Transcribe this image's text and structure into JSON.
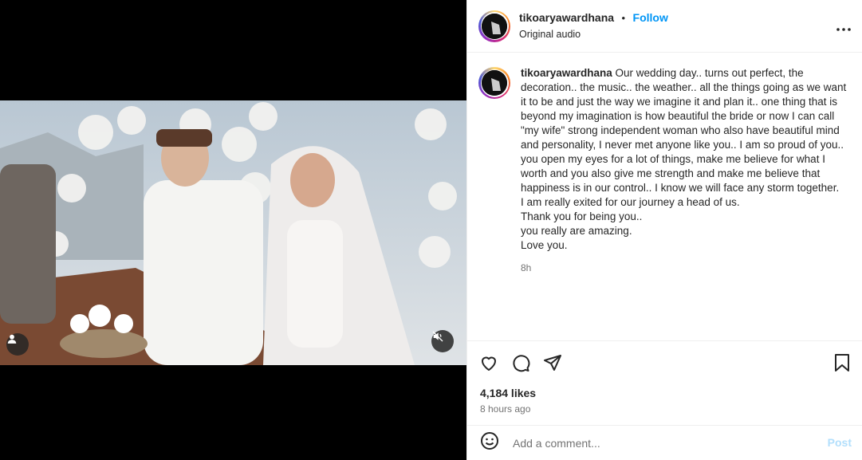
{
  "post": {
    "username": "tikoaryawardhana",
    "separator": "•",
    "follow_label": "Follow",
    "audio": "Original audio",
    "more_label": "•••"
  },
  "caption": {
    "username": "tikoaryawardhana",
    "text": " Our wedding day.. turns out perfect, the decoration.. the music.. the weather.. all the things going as we want it to be and just the way we imagine it and plan it.. one thing that is beyond my imagination is how beautiful the bride or now I can call \"my wife\" strong independent woman who also have beautiful mind and personality, I never met anyone like you.. I am so proud of you.. you open my eyes for a lot of things, make me believe for what I worth and you also give me strength and make me believe that happiness is in our control.. I know we will face any storm together.\nI am really exited for our journey a head of us.\nThank you for being you..\nyou really are amazing.\nLove you.",
    "time": "8h"
  },
  "stats": {
    "likes": "4,184 likes",
    "posted": "8 hours ago"
  },
  "comment": {
    "placeholder": "Add a comment...",
    "post_label": "Post"
  },
  "icons": {
    "like": "heart-icon",
    "comment": "comment-bubble-icon",
    "share": "paper-plane-icon",
    "save": "bookmark-icon",
    "emoji": "smiley-icon",
    "mute": "muted-speaker-icon",
    "tags": "user-tag-icon"
  }
}
